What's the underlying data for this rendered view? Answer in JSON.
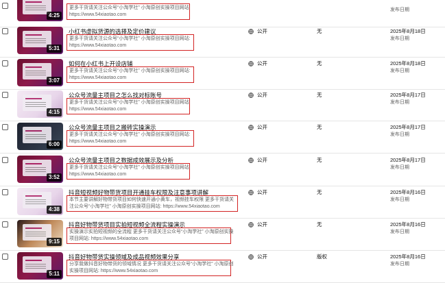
{
  "rows": [
    {
      "title": "",
      "desc": [
        "更多干货请关注公众号“小淘学社” 小淘原创实操项目网站:",
        "https://www.54xiaotao.com"
      ],
      "duration": "4:25",
      "visibility": "",
      "restriction": "",
      "date": "",
      "date_sub": "发布日期"
    },
    {
      "title": "小红书虚拟货源的选择及定价建议",
      "desc": [
        "更多干货请关注公众号“小淘学社” 小淘原创实操项目网站:",
        "https://www.54xiaotao.com"
      ],
      "duration": "5:31",
      "visibility": "公开",
      "restriction": "无",
      "date": "2025年8月18日",
      "date_sub": "发布日期"
    },
    {
      "title": "如何在小红书上开设店铺",
      "desc": [
        "更多干货请关注公众号“小淘学社” 小淘原创实操项目网站:",
        "https://www.54xiaotao.com"
      ],
      "duration": "3:07",
      "visibility": "公开",
      "restriction": "无",
      "date": "2025年8月18日",
      "date_sub": "发布日期"
    },
    {
      "title": "公众号流量主项目之怎么找对标账号",
      "desc": [
        "更多干货请关注公众号“小淘学社” 小淘原创实操项目网站:",
        "https://www.54xiaotao.com"
      ],
      "duration": "4:15",
      "visibility": "公开",
      "restriction": "无",
      "date": "2025年8月17日",
      "date_sub": "发布日期"
    },
    {
      "title": "公众号流量主项目之搬砖实操演示",
      "desc": [
        "更多干货请关注公众号“小淘学社” 小淘原创实操项目网站:",
        "https://www.54xiaotao.com"
      ],
      "duration": "6:00",
      "visibility": "公开",
      "restriction": "无",
      "date": "2025年8月17日",
      "date_sub": "发布日期"
    },
    {
      "title": "公众号流量主项目之数据成效展示及分析",
      "desc": [
        "更多干货请关注公众号“小淘学社” 小淘原创实操项目网站:",
        "https://www.54xiaotao.com"
      ],
      "duration": "3:52",
      "visibility": "公开",
      "restriction": "无",
      "date": "2025年8月17日",
      "date_sub": "发布日期"
    },
    {
      "title": "抖音短视频好物带货项目开通挂车权限及注意事项讲解",
      "desc": [
        "本节主要讲解好物带货项目如何快速开通小黄车，视频挂车权限 更多干货请关",
        "注公众号“小淘学社” 小淘原创实操项目网站: https://www.54xiaotao.com"
      ],
      "duration": "4:38",
      "visibility": "公开",
      "restriction": "无",
      "date": "2025年8月16日",
      "date_sub": "发布日期"
    },
    {
      "title": "抖音好物带货项目实拍短视频全流程实操演示",
      "desc": [
        "实操演示实拍短视频的全流程 更多干货请关注公众号“小淘学社” 小淘原创实操",
        "项目网站: https://www.54xiaotao.com"
      ],
      "duration": "9:15",
      "visibility": "公开",
      "restriction": "无",
      "date": "2025年8月16日",
      "date_sub": "发布日期"
    },
    {
      "title": "抖音好物带货实操领域及成品视频效果分享",
      "desc": [
        "分享我做抖音好物带货的领域情况 更多干货请关注公众号“小淘学社” 小淘原创",
        "实操项目网站: https://www.54xiaotao.com"
      ],
      "duration": "5:11",
      "visibility": "公开",
      "restriction": "版权",
      "date": "2025年8月16日",
      "date_sub": "发布日期"
    }
  ],
  "colors": {
    "highlight_border": "#d22222"
  },
  "icons": {
    "visibility": "globe-icon"
  }
}
